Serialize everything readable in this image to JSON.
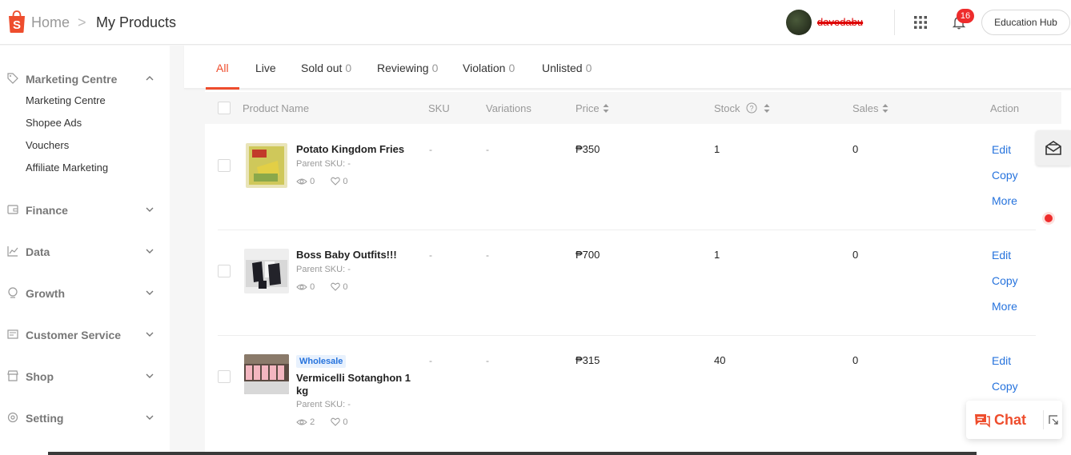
{
  "header": {
    "breadcrumb_home": "Home",
    "breadcrumb_sep": ">",
    "breadcrumb_current": "My Products",
    "username": "davedabu",
    "notification_count": "16",
    "education_hub": "Education Hub"
  },
  "sidebar": {
    "sections": [
      {
        "label": "Marketing Centre",
        "icon": "tag-icon",
        "expanded": true,
        "items": [
          "Marketing Centre",
          "Shopee Ads",
          "Vouchers",
          "Affiliate Marketing"
        ]
      },
      {
        "label": "Finance",
        "icon": "wallet-icon"
      },
      {
        "label": "Data",
        "icon": "chart-icon"
      },
      {
        "label": "Growth",
        "icon": "growth-icon"
      },
      {
        "label": "Customer Service",
        "icon": "customer-service-icon"
      },
      {
        "label": "Shop",
        "icon": "shop-icon"
      },
      {
        "label": "Setting",
        "icon": "settings-icon"
      }
    ]
  },
  "tabs": [
    {
      "label": "All",
      "count": ""
    },
    {
      "label": "Live",
      "count": ""
    },
    {
      "label": "Sold out",
      "count": "0"
    },
    {
      "label": "Reviewing",
      "count": "0"
    },
    {
      "label": "Violation",
      "count": "0"
    },
    {
      "label": "Unlisted",
      "count": "0"
    }
  ],
  "table": {
    "headers": {
      "product_name": "Product Name",
      "sku": "SKU",
      "variations": "Variations",
      "price": "Price",
      "stock": "Stock",
      "sales": "Sales",
      "action": "Action"
    },
    "rows": [
      {
        "name": "Potato Kingdom Fries",
        "badge": "",
        "parent_sku": "Parent SKU: -",
        "views": "0",
        "likes": "0",
        "sku": "-",
        "variations": "-",
        "price": "₱350",
        "stock": "1",
        "sales": "0",
        "actions": [
          "Edit",
          "Copy",
          "More"
        ]
      },
      {
        "name": "Boss Baby Outfits!!!",
        "badge": "",
        "parent_sku": "Parent SKU: -",
        "views": "0",
        "likes": "0",
        "sku": "-",
        "variations": "-",
        "price": "₱700",
        "stock": "1",
        "sales": "0",
        "actions": [
          "Edit",
          "Copy",
          "More"
        ]
      },
      {
        "name": "Vermicelli Sotanghon 1 kg",
        "badge": "Wholesale",
        "parent_sku": "Parent SKU: -",
        "views": "2",
        "likes": "0",
        "sku": "-",
        "variations": "-",
        "price": "₱315",
        "stock": "40",
        "sales": "0",
        "actions": [
          "Edit",
          "Copy"
        ]
      }
    ]
  },
  "chat": {
    "label": "Chat"
  },
  "colors": {
    "brand": "#ee4d2d",
    "link": "#2673dd",
    "badge": "#ee2c2c"
  }
}
